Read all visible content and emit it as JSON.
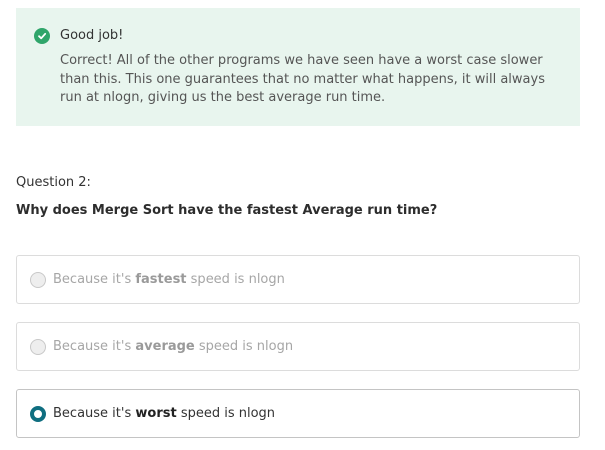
{
  "feedback": {
    "status_icon": "check-circle-icon",
    "status_color": "#2fa56a",
    "background_color": "#e8f5ee",
    "title": "Good job!",
    "message": "Correct! All of the other programs we have seen have a worst case slower than this. This one guarantees that no matter what happens, it will always run at nlogn, giving us the best average run time."
  },
  "question": {
    "label": "Question 2:",
    "text_before": "Why does Merge Sort have the fastest ",
    "text_emphasis": "Average",
    "text_after": " run time?"
  },
  "options": [
    {
      "prefix": "Because it's ",
      "emphasis": "fastest",
      "suffix": " speed is nlogn",
      "selected": false,
      "disabled": true
    },
    {
      "prefix": "Because it's ",
      "emphasis": "average",
      "suffix": " speed is nlogn",
      "selected": false,
      "disabled": true
    },
    {
      "prefix": "Because it's ",
      "emphasis": "worst",
      "suffix": " speed is nlogn",
      "selected": true,
      "disabled": false
    }
  ],
  "accent_color": "#0f6e80"
}
